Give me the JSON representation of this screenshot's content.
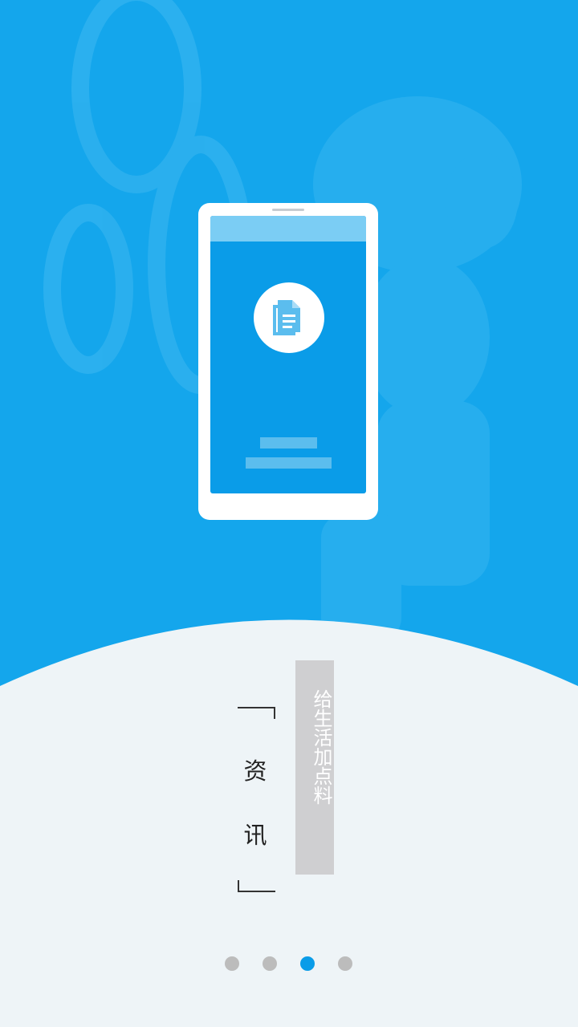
{
  "colors": {
    "background_blue": "#14a6ec",
    "accent_blue": "#0a9ce8",
    "light_panel": "#eef4f7",
    "slogan_box": "#cfcfd1",
    "dot_inactive": "#bcbcbc"
  },
  "illustration": {
    "icon": "document-copy-icon"
  },
  "feature": {
    "title_chars": [
      "资",
      "讯"
    ],
    "slogan": "给生活加点料"
  },
  "pager": {
    "total": 4,
    "active_index": 2
  }
}
